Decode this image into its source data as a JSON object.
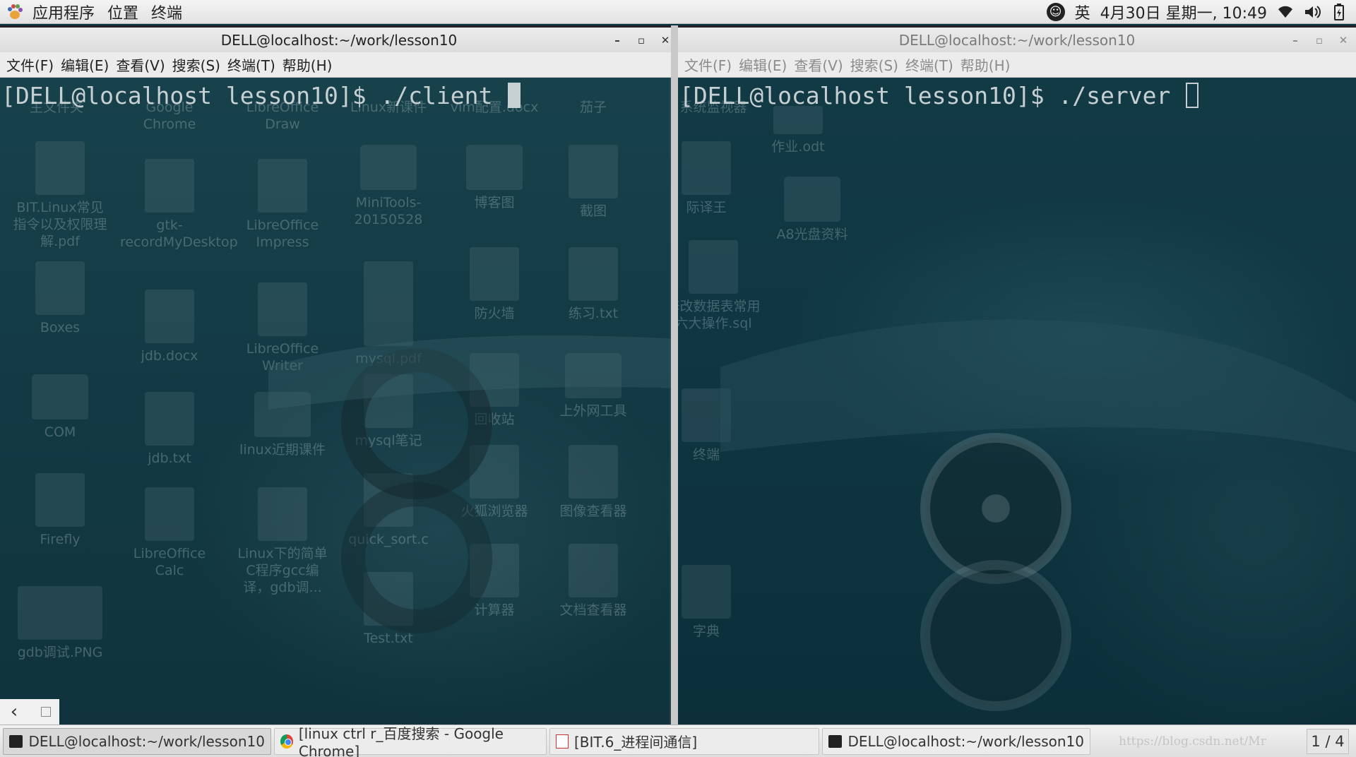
{
  "top_panel": {
    "applications_label": "应用程序",
    "places_label": "位置",
    "terminal_label": "终端",
    "input_method": "英",
    "clock": "4月30日 星期一, 10:49"
  },
  "terminal_left": {
    "title": "DELL@localhost:~/work/lesson10",
    "menus": [
      "文件(F)",
      "编辑(E)",
      "查看(V)",
      "搜索(S)",
      "终端(T)",
      "帮助(H)"
    ],
    "prompt": "[DELL@localhost lesson10]$ ./client "
  },
  "terminal_right": {
    "title": "DELL@localhost:~/work/lesson10",
    "menus": [
      "文件(F)",
      "编辑(E)",
      "查看(V)",
      "搜索(S)",
      "终端(T)",
      "帮助(H)"
    ],
    "prompt": "[DELL@localhost lesson10]$ ./server "
  },
  "desktop_icons": [
    "主文件夹",
    "Google Chrome",
    "LibreOffice Draw",
    "Linux新课件",
    "vim配置.docx",
    "茄子",
    "BIT.Linux常见指令以及权限理解.pdf",
    "gtk-recordMyDesktop",
    "LibreOffice Impress",
    "MiniTools-20150528",
    "博客图",
    "截图",
    "Boxes",
    "jdb.docx",
    "LibreOffice Writer",
    "mysql.pdf",
    "防火墙",
    "练习.txt",
    "COM",
    "jdb.txt",
    "linux近期课件",
    "mysql笔记",
    "回收站",
    "上外网工具",
    "Firefly",
    "LibreOffice Calc",
    "Linux下的简单C程序gcc编译，gdb调...",
    "quick_sort.c",
    "火狐浏览器",
    "图像查看器",
    "gdb调试.PNG",
    "Test.txt",
    "计算器",
    "文档查看器",
    "系统监视器",
    "作业.odt",
    "际译王",
    "A8光盘资料",
    "修改数据表常用六大操作.sql",
    "终端",
    "字典"
  ],
  "taskbar": {
    "tasks": [
      "DELL@localhost:~/work/lesson10",
      "[linux ctrl r_百度搜索 - Google Chrome]",
      "[BIT.6_进程间通信]",
      "DELL@localhost:~/work/lesson10"
    ],
    "watermark": "https://blog.csdn.net/Mr",
    "workspace": "1 / 4"
  }
}
